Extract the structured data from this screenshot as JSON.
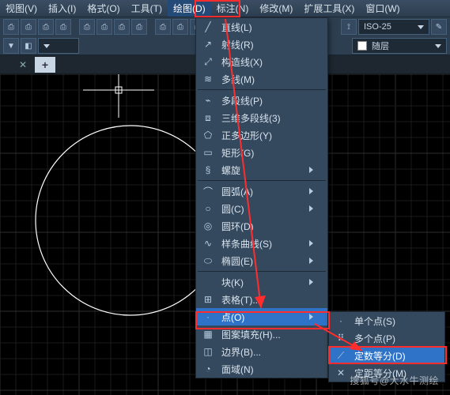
{
  "menubar": {
    "items": [
      {
        "label": "视图(V)"
      },
      {
        "label": "插入(I)"
      },
      {
        "label": "格式(O)"
      },
      {
        "label": "工具(T)"
      },
      {
        "label": "绘图(D)"
      },
      {
        "label": "标注(N)"
      },
      {
        "label": "修改(M)"
      },
      {
        "label": "扩展工具(X)"
      },
      {
        "label": "窗口(W)"
      }
    ],
    "active_index": 4
  },
  "toolbar": {
    "style_selector": "ISO-25",
    "layer_selector": "随层"
  },
  "tabs": {
    "close": "✕",
    "add": "+"
  },
  "dropdown_main": {
    "items": [
      {
        "icon": "╱",
        "label": "直线(L)",
        "sub": false
      },
      {
        "icon": "↗",
        "label": "射线(R)",
        "sub": false
      },
      {
        "icon": "⤢",
        "label": "构造线(X)",
        "sub": false
      },
      {
        "icon": "≋",
        "label": "多线(M)",
        "sub": false
      },
      {
        "div": true
      },
      {
        "icon": "⌁",
        "label": "多段线(P)",
        "sub": false
      },
      {
        "icon": "⧈",
        "label": "三维多段线(3)",
        "sub": false
      },
      {
        "icon": "⬠",
        "label": "正多边形(Y)",
        "sub": false
      },
      {
        "icon": "▭",
        "label": "矩形(G)",
        "sub": false
      },
      {
        "icon": "§",
        "label": "螺旋",
        "sub": true
      },
      {
        "div": true
      },
      {
        "icon": "⌒",
        "label": "圆弧(A)",
        "sub": true
      },
      {
        "icon": "○",
        "label": "圆(C)",
        "sub": true
      },
      {
        "icon": "◎",
        "label": "圆环(D)",
        "sub": false
      },
      {
        "icon": "∿",
        "label": "样条曲线(S)",
        "sub": true
      },
      {
        "icon": "⬭",
        "label": "椭圆(E)",
        "sub": true
      },
      {
        "div": true
      },
      {
        "icon": "",
        "label": "块(K)",
        "sub": true
      },
      {
        "icon": "⊞",
        "label": "表格(T)...",
        "sub": false
      },
      {
        "icon": "·",
        "label": "点(O)",
        "sub": true,
        "hl": true
      },
      {
        "icon": "▦",
        "label": "图案填充(H)...",
        "sub": false
      },
      {
        "icon": "◫",
        "label": "边界(B)...",
        "sub": false
      },
      {
        "icon": "◔",
        "label": "面域(N)",
        "sub": false
      }
    ]
  },
  "dropdown_sub": {
    "items": [
      {
        "icon": "·",
        "label": "单个点(S)"
      },
      {
        "icon": "⠿",
        "label": "多个点(P)"
      },
      {
        "icon": "⟋",
        "label": "定数等分(D)",
        "hl": true
      },
      {
        "icon": "✕",
        "label": "定距等分(M)"
      }
    ]
  },
  "watermark": "搜狐号@大水牛测绘"
}
